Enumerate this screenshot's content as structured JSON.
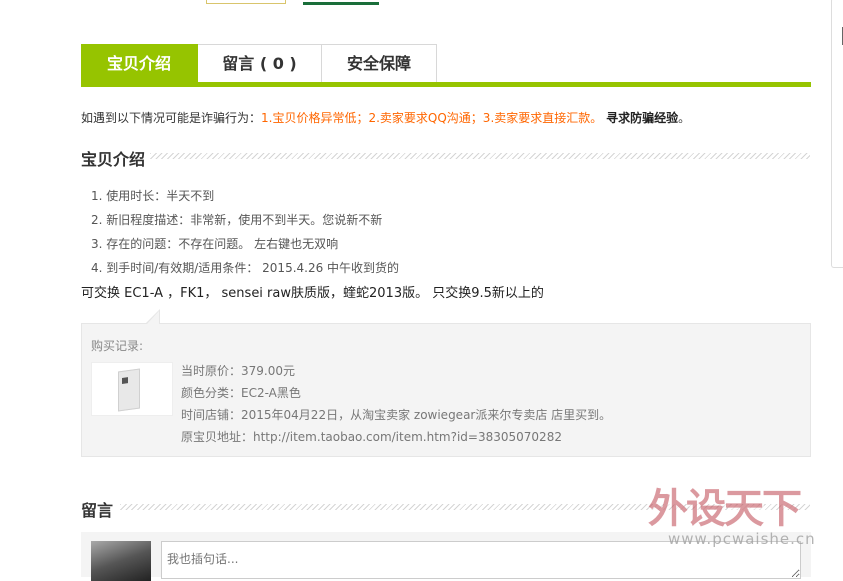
{
  "tabs": [
    {
      "label": "宝贝介绍",
      "active": true
    },
    {
      "label": "留言 ( 0 )",
      "active": false
    },
    {
      "label": "安全保障",
      "active": false
    }
  ],
  "warning": {
    "prefix": "如遇到以下情况可能是诈骗行为：",
    "highlight": "1.宝贝价格异常低；2.卖家要求QQ沟通；3.卖家要求直接汇款。",
    "strong": "寻求防骗经验",
    "suffix": "。"
  },
  "section_intro": {
    "title": "宝贝介绍"
  },
  "specs": [
    "1. 使用时长：半天不到",
    "2. 新旧程度描述：非常新，使用不到半天。您说新不新",
    "3. 存在的问题：不存在问题。 左右键也无双响",
    "4. 到手时间/有效期/适用条件： 2015.4.26 中午收到货的"
  ],
  "exchange_text": "可交换 EC1-A ，FK1， sensei raw肤质版，蝰蛇2013版。 只交换9.5新以上的",
  "purchase": {
    "title": "购买记录:",
    "lines": [
      "当时原价：379.00元",
      "颜色分类：EC2-A黑色",
      "时间店铺：2015年04月22日，从淘宝卖家 zowiegear派来尔专卖店 店里买到。",
      "原宝贝地址：http://item.taobao.com/item.htm?id=38305070282"
    ]
  },
  "comments": {
    "title": "留言",
    "placeholder": "我也插句话..."
  },
  "watermark": {
    "logo": "外设天下",
    "url": "www.pcwaishe.cn"
  },
  "colors": {
    "accent": "#96c400",
    "warning": "#ff6600"
  }
}
